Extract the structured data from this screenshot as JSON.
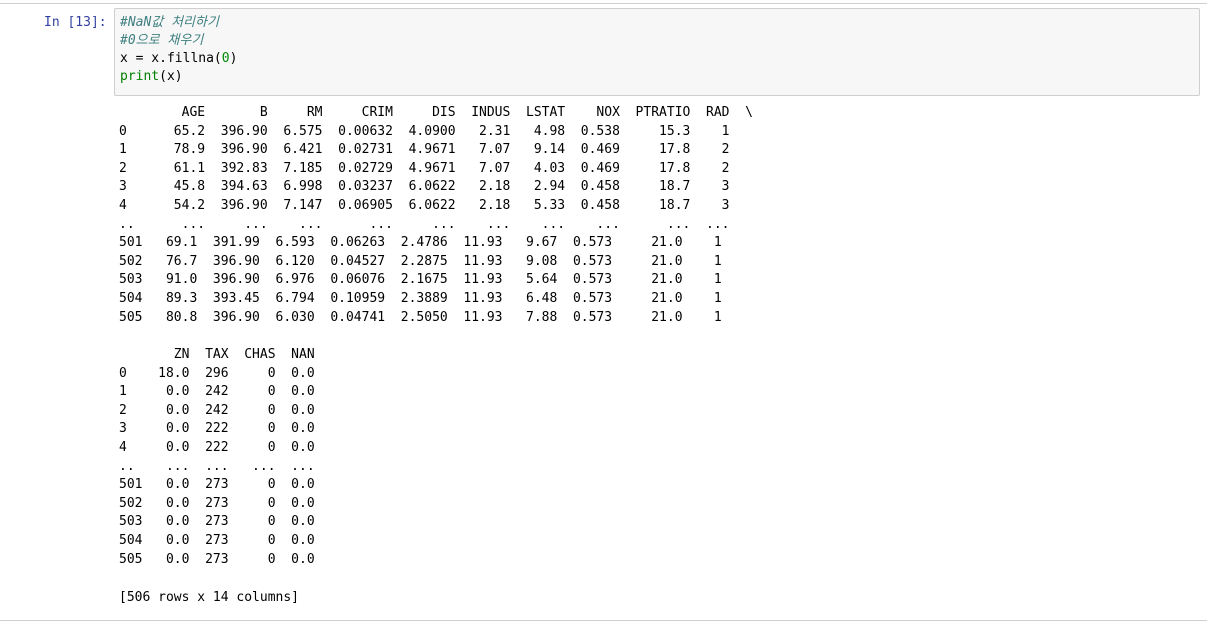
{
  "cell": {
    "prompt": "In [13]:",
    "code": {
      "line1": "#NaN값 처리하기",
      "line2": "#0으로 채우기",
      "line3_pre": "x = x.fillna(",
      "line3_num": "0",
      "line3_post": ")",
      "line4_builtin": "print",
      "line4_rest": "(x)"
    }
  },
  "output": {
    "table1": [
      "        AGE       B     RM     CRIM     DIS  INDUS  LSTAT    NOX  PTRATIO  RAD  \\",
      "0      65.2  396.90  6.575  0.00632  4.0900   2.31   4.98  0.538     15.3    1",
      "1      78.9  396.90  6.421  0.02731  4.9671   7.07   9.14  0.469     17.8    2",
      "2      61.1  392.83  7.185  0.02729  4.9671   7.07   4.03  0.469     17.8    2",
      "3      45.8  394.63  6.998  0.03237  6.0622   2.18   2.94  0.458     18.7    3",
      "4      54.2  396.90  7.147  0.06905  6.0622   2.18   5.33  0.458     18.7    3",
      "..      ...     ...    ...      ...     ...    ...    ...    ...      ...  ...",
      "501   69.1  391.99  6.593  0.06263  2.4786  11.93   9.67  0.573     21.0    1",
      "502   76.7  396.90  6.120  0.04527  2.2875  11.93   9.08  0.573     21.0    1",
      "503   91.0  396.90  6.976  0.06076  2.1675  11.93   5.64  0.573     21.0    1",
      "504   89.3  393.45  6.794  0.10959  2.3889  11.93   6.48  0.573     21.0    1",
      "505   80.8  396.90  6.030  0.04741  2.5050  11.93   7.88  0.573     21.0    1"
    ],
    "table2": [
      "       ZN  TAX  CHAS  NAN",
      "0    18.0  296     0  0.0",
      "1     0.0  242     0  0.0",
      "2     0.0  242     0  0.0",
      "3     0.0  222     0  0.0",
      "4     0.0  222     0  0.0",
      "..    ...  ...   ...  ...",
      "501   0.0  273     0  0.0",
      "502   0.0  273     0  0.0",
      "503   0.0  273     0  0.0",
      "504   0.0  273     0  0.0",
      "505   0.0  273     0  0.0"
    ],
    "summary": "[506 rows x 14 columns]"
  }
}
